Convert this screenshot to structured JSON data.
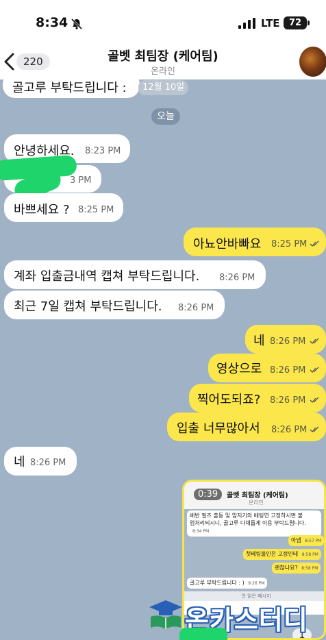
{
  "status_bar": {
    "time": "8:34",
    "network": "LTE",
    "battery": "72"
  },
  "header": {
    "back_count": "220",
    "title": "골벳 최팀장 (케어팀)",
    "subtitle": "온라인"
  },
  "date_tag": "12월 10일",
  "date_divider": "오늘",
  "messages": [
    {
      "side": "left",
      "text": "골고루 부탁드립니다 :",
      "time": ""
    },
    {
      "side": "left",
      "text": "안녕하세요.",
      "time": "8:23 PM"
    },
    {
      "side": "left",
      "text": "",
      "time": "3 PM"
    },
    {
      "side": "left",
      "text": "바쁘세요 ?",
      "time": "8:25 PM"
    },
    {
      "side": "right",
      "text": "아뇨안바빠요",
      "time": "8:25 PM"
    },
    {
      "side": "left",
      "text": "계좌 입출금내역 캡쳐 부탁드립니다.",
      "time": "8:26 PM"
    },
    {
      "side": "left",
      "text": "최근 7일 캡쳐 부탁드립니다.",
      "time": "8:26 PM"
    },
    {
      "side": "right",
      "text": "네",
      "time": "8:26 PM"
    },
    {
      "side": "right",
      "text": "영상으로",
      "time": "8:26 PM"
    },
    {
      "side": "right",
      "text": "찍어도되죠?",
      "time": "8:26 PM"
    },
    {
      "side": "right",
      "text": "입출 너무많아서",
      "time": "8:26 PM"
    },
    {
      "side": "left",
      "text": "네",
      "time": "8:26 PM"
    }
  ],
  "video": {
    "duration": "0:39",
    "title": "골벳 최팀장 (케어팀)",
    "subtitle": "온라인",
    "lines": [
      {
        "text": "배반 필즈 출동 및 앞지기의 배팅연 고정하시면 불",
        "time": ""
      },
      {
        "text": "업처리되시니, 골고루 다채롭게 이용 부탁드립니다.",
        "time": "8:34 PM"
      },
      {
        "text": "아넵",
        "time": "8:57 PM"
      },
      {
        "text": "첫베팅올인은 고정인테",
        "time": "8:58 PM"
      },
      {
        "text": "괜찮나요?",
        "time": "8:58 PM"
      },
      {
        "text": "골고루 부탁드립니다 : )",
        "time": "9:26 PM"
      }
    ],
    "unread": "안 읽은 메시지",
    "page": "1"
  },
  "watermark": "온카스터디",
  "colors": {
    "chat_bg": "#9fb2c6",
    "my_bubble": "#fbe64c",
    "their_bubble": "#ffffff"
  }
}
